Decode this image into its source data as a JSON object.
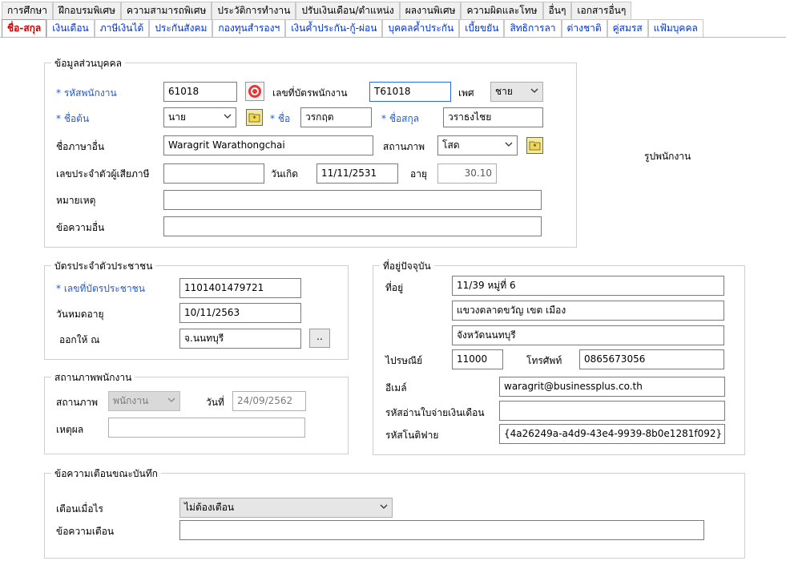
{
  "tabs_row1": [
    "การศึกษา",
    "ฝึกอบรมพิเศษ",
    "ความสามารถพิเศษ",
    "ประวัติการทำงาน",
    "ปรับเงินเดือน/ตำแหน่ง",
    "ผลงานพิเศษ",
    "ความผิดและโทษ",
    "อื่นๆ",
    "เอกสารอื่นๆ"
  ],
  "tabs_row2": [
    "ชื่อ-สกุล",
    "เงินเดือน",
    "ภาษีเงินได้",
    "ประกันสังคม",
    "กองทุนสำรองฯ",
    "เงินค้ำประกัน-กู้-ผ่อน",
    "บุคคลค้ำประกัน",
    "เบี้ยขยัน",
    "สิทธิการลา",
    "ต่างชาติ",
    "คู่สมรส",
    "แฟ้มบุคคล"
  ],
  "personal": {
    "legend": "ข้อมูลส่วนบุคคล",
    "emp_code_label": "* รหัสพนักงาน",
    "emp_code": "61018",
    "id_card_label": "เลขที่บัตรพนักงาน",
    "id_card": "T61018",
    "sex_label": "เพศ",
    "sex": "ชาย",
    "prefix_label": "* ชื่อต้น",
    "prefix": "นาย",
    "first_name_label": "* ชื่อ",
    "first_name": "วรกฤต",
    "last_name_label": "* ชื่อสกุล",
    "last_name": "วราธงไชย",
    "other_lang_label": "ชื่อภาษาอื่น",
    "other_lang": "Waragrit  Warathongchai",
    "marital_label": "สถานภาพ",
    "marital": "โสด",
    "tax_id_label": "เลขประจำตัวผู้เสียภาษี",
    "tax_id": "",
    "birth_label": "วันเกิด",
    "birth": "11/11/2531",
    "age_label": "อายุ",
    "age": "30.10",
    "note_label": "หมายเหตุ",
    "note": "",
    "other_msg_label": "ข้อความอื่น",
    "other_msg": "",
    "photo_label": "รูปพนักงาน"
  },
  "idcard": {
    "legend": "บัตรประจำตัวประชาชน",
    "number_label": "* เลขที่บัตรประชาชน",
    "number": "1101401479721",
    "expire_label": "วันหมดอายุ",
    "expire": "10/11/2563",
    "issued_label": "ออกให้ ณ",
    "issued": "จ.นนทบุรี",
    "browse": ".."
  },
  "address": {
    "legend": "ที่อยู่ปัจจุบัน",
    "addr_label": "ที่อยู่",
    "line1": "11/39 หมู่ที่ 6",
    "line2": "แขวงตลาดขวัญ เขต เมือง",
    "line3": "จังหวัดนนทบุรี",
    "zip_label": "ไปรษณีย์",
    "zip": "11000",
    "phone_label": "โทรศัพท์",
    "phone": "0865673056",
    "email_label": "อีเมล์",
    "email": "waragrit@businessplus.co.th",
    "payslip_label": "รหัสอ่านใบจ่ายเงินเดือน",
    "payslip": "",
    "notify_label": "รหัสโนติฟาย",
    "notify": "{4a26249a-a4d9-43e4-9939-8b0e1281f092}"
  },
  "status": {
    "legend": "สถานภาพพนักงาน",
    "status_label": "สถานภาพ",
    "status": "พนักงาน",
    "date_label": "วันที่",
    "date": "24/09/2562",
    "reason_label": "เหตุผล",
    "reason": ""
  },
  "warning": {
    "legend": "ข้อความเตือนขณะบันทึก",
    "when_label": "เตือนเมื่อไร",
    "when": "ไม่ต้องเตือน",
    "msg_label": "ข้อความเตือน",
    "msg": ""
  },
  "colors": {
    "required": "#1f5bd6",
    "active_tab": "#d00000",
    "tab_link": "#0033cc"
  }
}
